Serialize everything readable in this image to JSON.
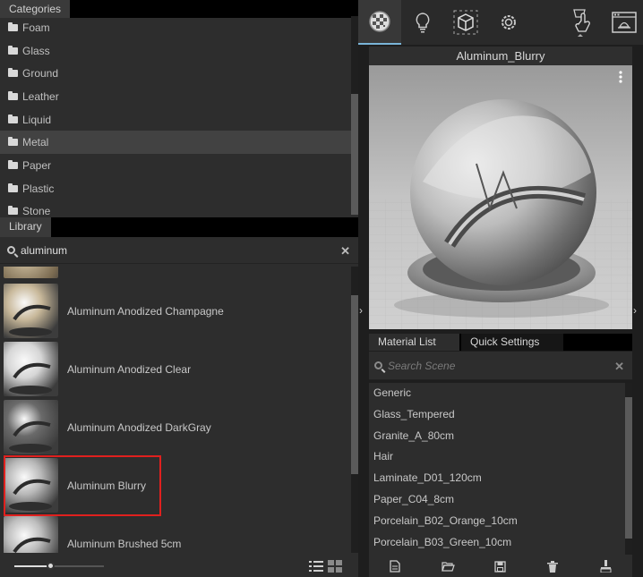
{
  "categories": {
    "tab_label": "Categories",
    "items": [
      "Foam",
      "Glass",
      "Ground",
      "Leather",
      "Liquid",
      "Metal",
      "Paper",
      "Plastic",
      "Stone"
    ],
    "selected": "Metal"
  },
  "library": {
    "tab_label": "Library",
    "search_value": "aluminum",
    "clear_icon": "close-icon",
    "items": [
      {
        "label": "Aluminum Anodized Champagne",
        "color": "#c8b89a"
      },
      {
        "label": "Aluminum Anodized Clear",
        "color": "#d6d6d6"
      },
      {
        "label": "Aluminum Anodized DarkGray",
        "color": "#6a6a6a"
      },
      {
        "label": "Aluminum Blurry",
        "color": "#b8b8b8"
      },
      {
        "label": "Aluminum Brushed 5cm",
        "color": "#bdbdbd"
      }
    ],
    "selected_index": 3,
    "zoom_slider": 0.4
  },
  "toolbar": {
    "buttons": [
      "material-ball-icon",
      "lightbulb-icon",
      "cube-icon",
      "gear-icon",
      "touch-render-icon",
      "render-window-icon"
    ]
  },
  "preview": {
    "title": "Aluminum_Blurry",
    "menu_icon": "more-vert-icon"
  },
  "material_list": {
    "tabs": [
      "Material List",
      "Quick Settings"
    ],
    "active_tab": "Material List",
    "search_placeholder": "Search Scene",
    "items": [
      "Generic",
      "Glass_Tempered",
      "Granite_A_80cm",
      "Hair",
      "Laminate_D01_120cm",
      "Paper_C04_8cm",
      "Porcelain_B02_Orange_10cm",
      "Porcelain_B03_Green_10cm"
    ],
    "bottom_buttons": [
      "new-file-icon",
      "open-folder-icon",
      "save-icon",
      "trash-icon",
      "brush-icon"
    ]
  }
}
